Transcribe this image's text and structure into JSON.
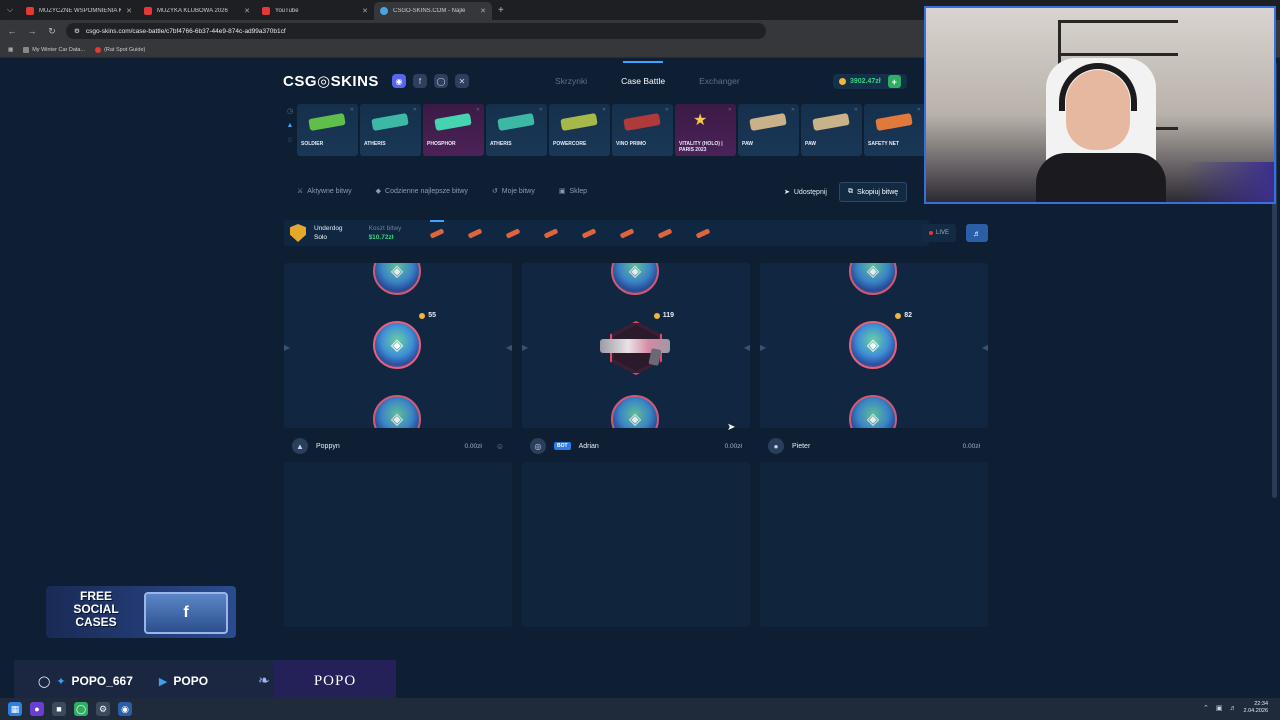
{
  "browser": {
    "tabs": [
      {
        "title": "MUZYCZNE WSPOMNIENIA KL",
        "active": false,
        "icon": "youtube"
      },
      {
        "title": "MUZYKA KLUBOWA 2026",
        "active": false,
        "icon": "youtube"
      },
      {
        "title": "YouTube",
        "active": false,
        "icon": "youtube"
      },
      {
        "title": "CSGO-SKINS.COM - Najle",
        "active": true,
        "icon": "csgo-skins"
      }
    ],
    "url": "csgo-skins.com/case-battle/c7bf4766-6b37-44e9-874c-ad99a370b1cf",
    "bookmarks": [
      "My Winter Car Data...",
      "(Rat Spot Guide)"
    ]
  },
  "site": {
    "logo": "CSG◎SKINS",
    "nav": [
      "Skrzynki",
      "Case Battle",
      "Exchanger"
    ],
    "active_nav": "Case Battle",
    "balance": "3902.47zł",
    "live_drops": [
      {
        "name": "SOLDIER",
        "color": "#5fbf4a",
        "pink": false
      },
      {
        "name": "ATHERIS",
        "color": "#3db8a5",
        "pink": false
      },
      {
        "name": "PHOSPHOR",
        "color": "#45d4b0",
        "pink": true
      },
      {
        "name": "ATHERIS",
        "color": "#3db8a5",
        "pink": false
      },
      {
        "name": "POWERCORE",
        "color": "#a7b84a",
        "pink": false
      },
      {
        "name": "VINO PRIMO",
        "color": "#b03a3a",
        "pink": false
      },
      {
        "name": "VITALITY (HOLO) | PARIS 2023",
        "color": "#f2c94c",
        "pink": true,
        "sticker": true
      },
      {
        "name": "PAW",
        "color": "#c9b28a",
        "pink": false
      },
      {
        "name": "PAW",
        "color": "#c9b28a",
        "pink": false
      },
      {
        "name": "SAFETY NET",
        "color": "#e07a3b",
        "pink": false
      }
    ],
    "battle_tabs": [
      "Aktywne bitwy",
      "Codzienne najlepsze bitwy",
      "Moje bitwy",
      "Sklep"
    ],
    "share_label": "Udostępnij",
    "copy_label": "Skopiuj bitwę",
    "mode_label": "Underdog",
    "mode_type": "Solo",
    "cost_label": "Koszt bitwy",
    "cost_value": "$10.72zł",
    "rounds_count": 8,
    "live_label": "LIVE",
    "columns": [
      {
        "reward": "55",
        "winner": "case"
      },
      {
        "reward": "119",
        "winner": "pistol"
      },
      {
        "reward": "82",
        "winner": "case"
      }
    ],
    "players": [
      {
        "name": "Poppyn",
        "value": "0.00zł",
        "bot": false
      },
      {
        "name": "Adrian",
        "value": "0.00zł",
        "bot": true,
        "bot_label": "BOT"
      },
      {
        "name": "Pieter",
        "value": "0.00zł",
        "bot": false
      }
    ]
  },
  "overlay": {
    "promo_text": "FREE SOCIAL CASES",
    "social_handle": "POPO_667",
    "youtube_name": "POPO",
    "streamer_name": "POPO"
  },
  "taskbar": {
    "time": "22:34",
    "date": "2.04.2026"
  }
}
